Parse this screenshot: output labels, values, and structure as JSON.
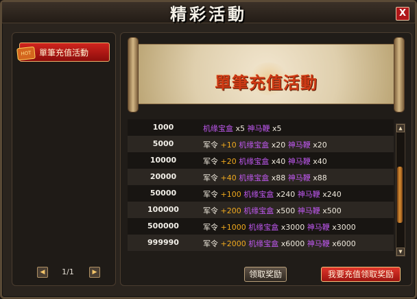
{
  "window": {
    "title": "精彩活動",
    "close_label": "X"
  },
  "sidebar": {
    "active_item": "單筆充值活動",
    "hot_badge": "HOT",
    "pager": {
      "prev_icon": "◀",
      "next_icon": "▶",
      "page_text": "1/1"
    }
  },
  "banner": {
    "title": "單筆充值活動"
  },
  "table": {
    "rows": [
      {
        "amount": "1000",
        "reward": [
          {
            "t": "机缘宝盒",
            "c": "p"
          },
          {
            "t": " x5 ",
            "c": "w"
          },
          {
            "t": "神马鞭",
            "c": "p"
          },
          {
            "t": " x5",
            "c": "w"
          }
        ]
      },
      {
        "amount": "5000",
        "reward": [
          {
            "t": "军令",
            "c": "w"
          },
          {
            "t": " +10 ",
            "c": "o"
          },
          {
            "t": "机缘宝盒",
            "c": "p"
          },
          {
            "t": " x20 ",
            "c": "w"
          },
          {
            "t": "神马鞭",
            "c": "p"
          },
          {
            "t": " x20",
            "c": "w"
          }
        ]
      },
      {
        "amount": "10000",
        "reward": [
          {
            "t": "军令",
            "c": "w"
          },
          {
            "t": " +20 ",
            "c": "o"
          },
          {
            "t": "机缘宝盒",
            "c": "p"
          },
          {
            "t": " x40 ",
            "c": "w"
          },
          {
            "t": "神马鞭",
            "c": "p"
          },
          {
            "t": " x40",
            "c": "w"
          }
        ]
      },
      {
        "amount": "20000",
        "reward": [
          {
            "t": "军令",
            "c": "w"
          },
          {
            "t": " +40 ",
            "c": "o"
          },
          {
            "t": "机缘宝盒",
            "c": "p"
          },
          {
            "t": " x88 ",
            "c": "w"
          },
          {
            "t": "神马鞭",
            "c": "p"
          },
          {
            "t": " x88",
            "c": "w"
          }
        ]
      },
      {
        "amount": "50000",
        "reward": [
          {
            "t": "军令",
            "c": "w"
          },
          {
            "t": " +100 ",
            "c": "o"
          },
          {
            "t": "机缘宝盒",
            "c": "p"
          },
          {
            "t": " x240 ",
            "c": "w"
          },
          {
            "t": "神马鞭",
            "c": "p"
          },
          {
            "t": " x240",
            "c": "w"
          }
        ]
      },
      {
        "amount": "100000",
        "reward": [
          {
            "t": "军令",
            "c": "w"
          },
          {
            "t": " +200 ",
            "c": "o"
          },
          {
            "t": "机缘宝盒",
            "c": "p"
          },
          {
            "t": " x500 ",
            "c": "w"
          },
          {
            "t": "神马鞭",
            "c": "p"
          },
          {
            "t": " x500",
            "c": "w"
          }
        ]
      },
      {
        "amount": "500000",
        "reward": [
          {
            "t": "军令",
            "c": "w"
          },
          {
            "t": " +1000 ",
            "c": "o"
          },
          {
            "t": "机缘宝盒",
            "c": "p"
          },
          {
            "t": " x3000 ",
            "c": "w"
          },
          {
            "t": "神马鞭",
            "c": "p"
          },
          {
            "t": " x3000",
            "c": "w"
          }
        ]
      },
      {
        "amount": "999990",
        "reward": [
          {
            "t": "军令",
            "c": "w"
          },
          {
            "t": " +2000 ",
            "c": "o"
          },
          {
            "t": "机缘宝盒",
            "c": "p"
          },
          {
            "t": " x6000 ",
            "c": "w"
          },
          {
            "t": "神马鞭",
            "c": "p"
          },
          {
            "t": " x6000",
            "c": "w"
          }
        ]
      }
    ]
  },
  "buttons": {
    "claim": "领取奖励",
    "recharge": "我要充值领取奖励"
  },
  "scrollbar": {
    "up_icon": "▲",
    "down_icon": "▼"
  },
  "colors": {
    "white_text": "#efe9dd",
    "orange_text": "#f0a91e",
    "purple_text": "#bf58f0"
  }
}
